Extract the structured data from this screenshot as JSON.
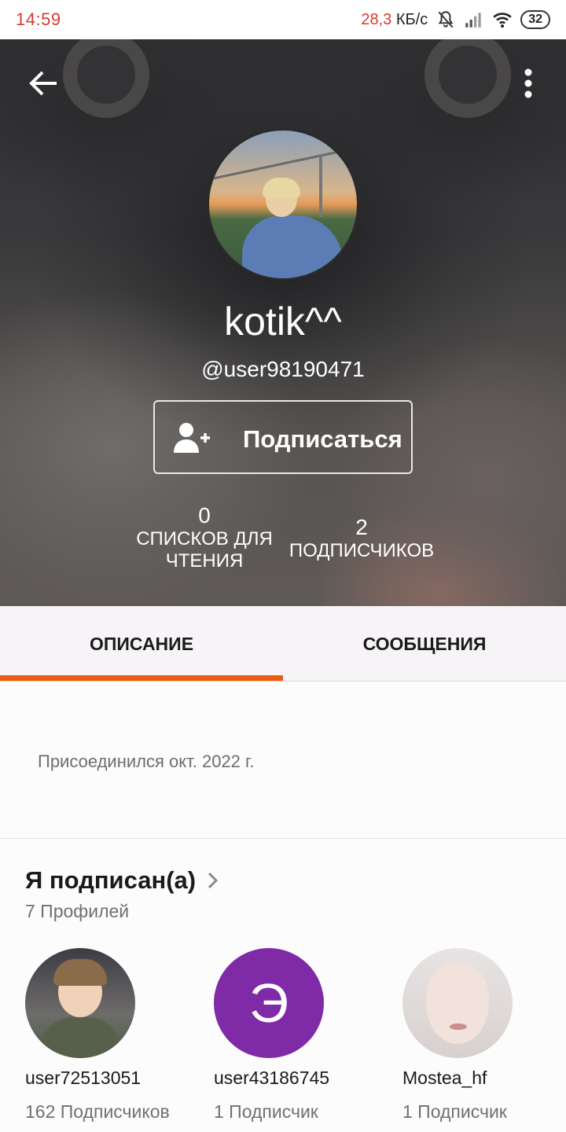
{
  "status_bar": {
    "time": "14:59",
    "speed_value": "28,3",
    "speed_unit": "КБ/с",
    "battery": "32"
  },
  "profile": {
    "display_name": "kotik^^",
    "handle": "@user98190471",
    "follow_label": "Подписаться",
    "stats": [
      {
        "value": "0",
        "label": "СПИСКОВ ДЛЯ ЧТЕНИЯ"
      },
      {
        "value": "2",
        "label": "ПОДПИСЧИКОВ"
      }
    ]
  },
  "tabs": [
    {
      "label": "ОПИСАНИЕ",
      "active": true
    },
    {
      "label": "СООБЩЕНИЯ",
      "active": false
    }
  ],
  "accent_color": "#f15a14",
  "description": {
    "joined": "Присоединился окт. 2022 г."
  },
  "following": {
    "title": "Я подписан(а)",
    "count_label": "7 Профилей",
    "profiles": [
      {
        "username": "user72513051",
        "followers": "162 Подписчиков"
      },
      {
        "username": "user43186745",
        "followers": "1 Подписчик",
        "initial": "Э",
        "avatar_color": "#7f2aa6"
      },
      {
        "username": "Mostea_hf",
        "followers": "1 Подписчик"
      }
    ]
  }
}
